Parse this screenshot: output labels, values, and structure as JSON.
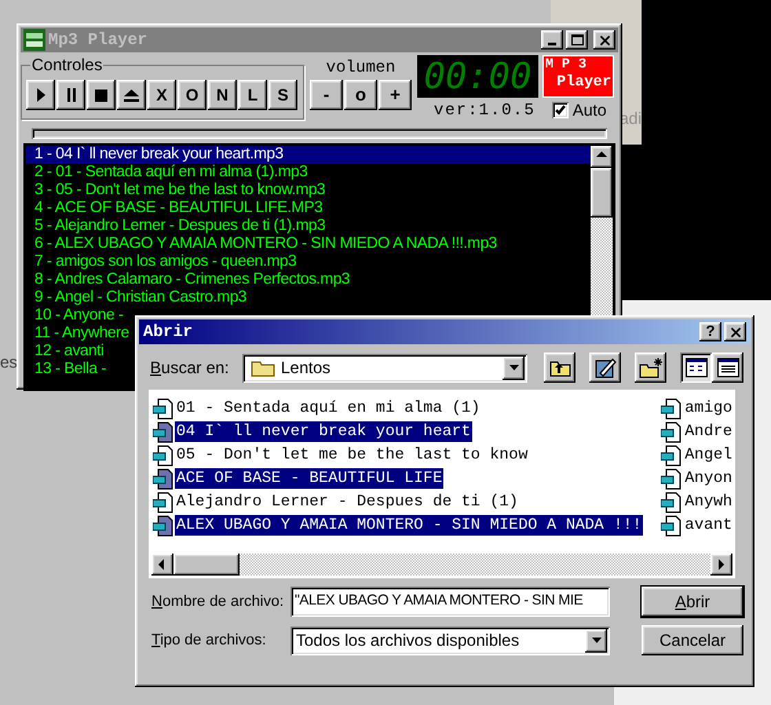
{
  "background_app": {
    "texts": [
      "adi",
      "es"
    ]
  },
  "player": {
    "title": "Mp3 Player",
    "controls_label": "Controles",
    "letter_buttons": [
      "X",
      "O",
      "N",
      "L",
      "S"
    ],
    "volume_label": "volumen",
    "volume_buttons": [
      "-",
      "o",
      "+"
    ],
    "time": "00:00",
    "logo": {
      "line_1": "M P 3",
      "line_2": "Player"
    },
    "version": "ver:1.0.5",
    "auto": {
      "label": "Auto",
      "checked": true
    },
    "playlist": [
      {
        "text": "1 - 04 I` ll never break your heart.mp3",
        "selected": true
      },
      {
        "text": "2 - 01 - Sentada aquí en mi alma (1).mp3",
        "selected": false
      },
      {
        "text": "3 - 05 - Don't let me be the last to know.mp3",
        "selected": false
      },
      {
        "text": "4 - ACE OF BASE - BEAUTIFUL LIFE.MP3",
        "selected": false
      },
      {
        "text": "5 - Alejandro Lerner - Despues de ti (1).mp3",
        "selected": false
      },
      {
        "text": "6 - ALEX UBAGO Y AMAIA MONTERO - SIN MIEDO A NADA !!!.mp3",
        "selected": false
      },
      {
        "text": "7 - amigos son los amigos - queen.mp3",
        "selected": false
      },
      {
        "text": "8 - Andres Calamaro - Crimenes Perfectos.mp3",
        "selected": false
      },
      {
        "text": "9 - Angel - Christian Castro.mp3",
        "selected": false
      },
      {
        "text": "10 - Anyone -",
        "selected": false
      },
      {
        "text": "11 - Anywhere",
        "selected": false
      },
      {
        "text": "12 - avanti",
        "selected": false
      },
      {
        "text": "13 - Bella -",
        "selected": false
      }
    ]
  },
  "dialog": {
    "title": "Abrir",
    "help": "?",
    "look_in_label": "Buscar en:",
    "folder": "Lentos",
    "files": [
      {
        "name": "01 - Sentada aquí en mi alma (1)",
        "selected": false
      },
      {
        "name": "04 I` ll never break your heart",
        "selected": true
      },
      {
        "name": "05 - Don't let me be the last to know",
        "selected": false
      },
      {
        "name": "ACE OF BASE - BEAUTIFUL LIFE",
        "selected": true
      },
      {
        "name": "Alejandro Lerner - Despues de ti (1)",
        "selected": false
      },
      {
        "name": "ALEX UBAGO Y AMAIA MONTERO - SIN MIEDO A NADA !!!",
        "selected": true
      }
    ],
    "files_column_2": [
      "amigo",
      "Andre",
      "Angel",
      "Anyon",
      "Anywh",
      "avant"
    ],
    "file_name_label": "Nombre de archivo:",
    "file_name_value": "\"ALEX UBAGO Y AMAIA MONTERO - SIN MIE",
    "file_type_label": "Tipo de archivos:",
    "file_type_value": "Todos los archivos disponibles",
    "buttons": [
      "Abrir",
      "Cancelar"
    ]
  }
}
